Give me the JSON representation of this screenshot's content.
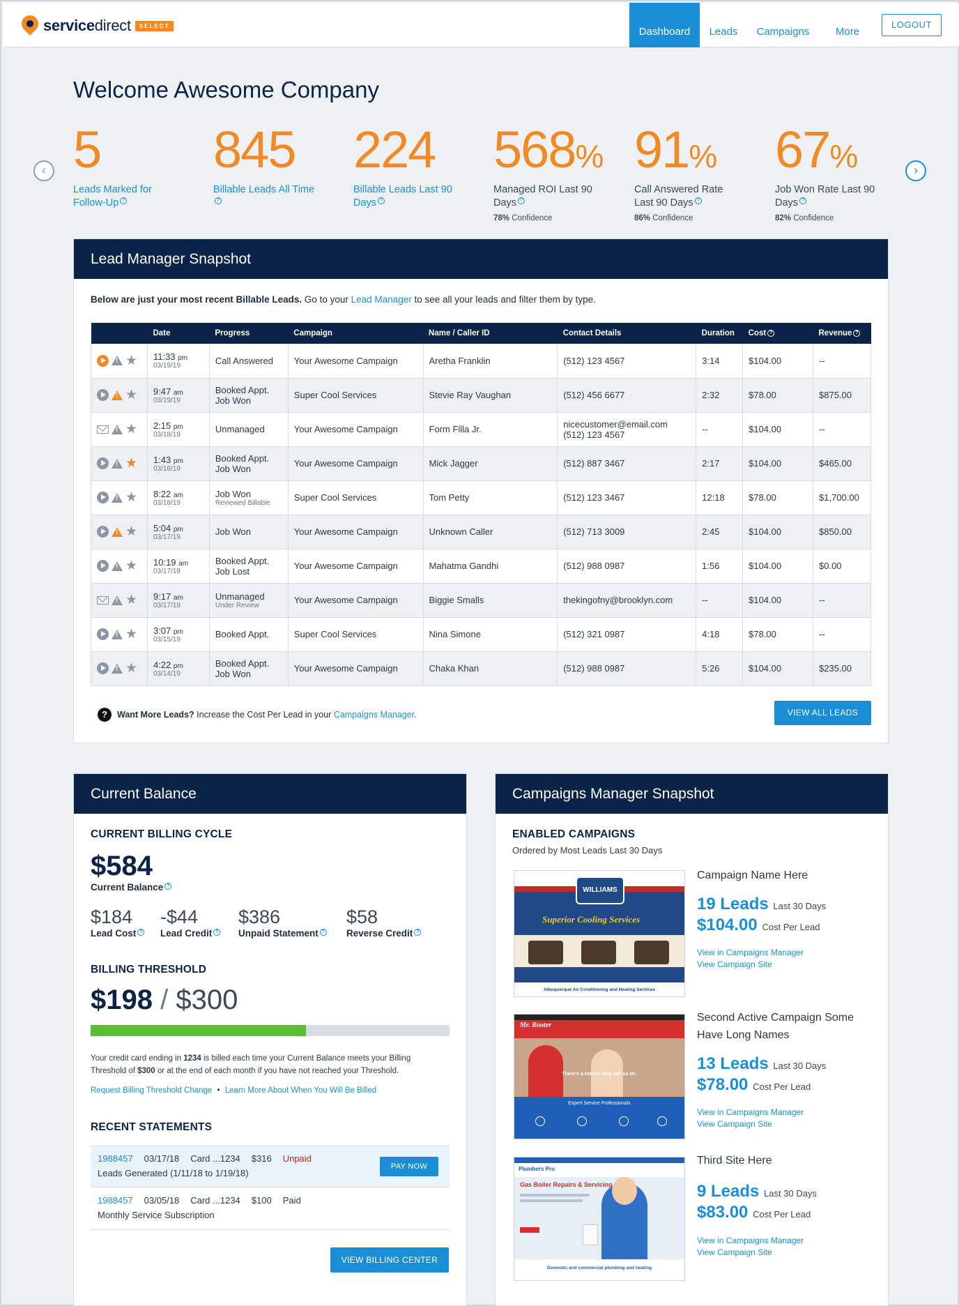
{
  "brand": {
    "name_bold": "service",
    "name_light": "direct",
    "badge": "SELECT"
  },
  "nav": {
    "items": [
      "Dashboard",
      "Leads",
      "Campaigns",
      "More"
    ],
    "logout": "LOGOUT"
  },
  "welcome": "Welcome Awesome Company",
  "stats": [
    {
      "value": "5",
      "suffix": "",
      "label": "Leads Marked for Follow-Up",
      "confidence_pct": "",
      "confidence_label": ""
    },
    {
      "value": "845",
      "suffix": "",
      "label": "Billable Leads All Time",
      "confidence_pct": "",
      "confidence_label": ""
    },
    {
      "value": "224",
      "suffix": "",
      "label": "Billable Leads Last 90 Days",
      "confidence_pct": "",
      "confidence_label": ""
    },
    {
      "value": "568",
      "suffix": "%",
      "label": "Managed ROI Last 90 Days",
      "confidence_pct": "78%",
      "confidence_label": "Confidence"
    },
    {
      "value": "91",
      "suffix": "%",
      "label": "Call Answered Rate Last 90 Days",
      "confidence_pct": "86%",
      "confidence_label": "Confidence"
    },
    {
      "value": "67",
      "suffix": "%",
      "label": "Job Won Rate Last 90 Days",
      "confidence_pct": "82%",
      "confidence_label": "Confidence"
    }
  ],
  "lead_snapshot": {
    "title": "Lead Manager Snapshot",
    "intro_bold": "Below are just your most recent Billable Leads.",
    "intro_pre": " Go to your ",
    "intro_link": "Lead Manager",
    "intro_post": " to see all your leads and filter them by type.",
    "columns": [
      "Date",
      "Progress",
      "Campaign",
      "Name / Caller ID",
      "Contact Details",
      "Duration",
      "Cost",
      "Revenue"
    ],
    "rows": [
      {
        "icon": "play",
        "play_on": true,
        "warn_on": false,
        "star_on": false,
        "time": "11:33",
        "ampm": "pm",
        "date": "03/19/19",
        "progress": "Call Answered",
        "progress2": "",
        "progress_sub": "",
        "campaign": "Your Awesome Campaign",
        "name": "Aretha Franklin",
        "contact": "(512) 123 4567",
        "contact2": "",
        "duration": "3:14",
        "cost": "$104.00",
        "revenue": "--"
      },
      {
        "icon": "play",
        "play_on": false,
        "warn_on": true,
        "star_on": false,
        "time": "9:47",
        "ampm": "am",
        "date": "03/19/19",
        "progress": "Booked Appt.",
        "progress2": "Job Won",
        "progress_sub": "",
        "campaign": "Super Cool Services",
        "name": "Stevie Ray Vaughan",
        "contact": "(512) 456 6677",
        "contact2": "",
        "duration": "2:32",
        "cost": "$78.00",
        "revenue": "$875.00"
      },
      {
        "icon": "mail",
        "play_on": false,
        "warn_on": false,
        "star_on": false,
        "time": "2:15",
        "ampm": "pm",
        "date": "03/18/19",
        "progress": "Unmanaged",
        "progress2": "",
        "progress_sub": "",
        "campaign": "Your Awesome Campaign",
        "name": "Form Filla Jr.",
        "contact": "nicecustomer@email.com",
        "contact2": "(512) 123 4567",
        "duration": "--",
        "cost": "$104.00",
        "revenue": "--"
      },
      {
        "icon": "play",
        "play_on": false,
        "warn_on": false,
        "star_on": true,
        "time": "1:43",
        "ampm": "pm",
        "date": "03/18/19",
        "progress": "Booked Appt.",
        "progress2": "Job Won",
        "progress_sub": "",
        "campaign": "Your Awesome Campaign",
        "name": "Mick Jagger",
        "contact": "(512) 887 3467",
        "contact2": "",
        "duration": "2:17",
        "cost": "$104.00",
        "revenue": "$465.00"
      },
      {
        "icon": "play",
        "play_on": false,
        "warn_on": false,
        "star_on": false,
        "time": "8:22",
        "ampm": "am",
        "date": "03/18/19",
        "progress": "Job Won",
        "progress2": "",
        "progress_sub": "Reviewed Billable",
        "campaign": "Super Cool Services",
        "name": "Tom Petty",
        "contact": "(512) 123 3467",
        "contact2": "",
        "duration": "12:18",
        "cost": "$78.00",
        "revenue": "$1,700.00"
      },
      {
        "icon": "play",
        "play_on": false,
        "warn_on": true,
        "star_on": false,
        "time": "5:04",
        "ampm": "pm",
        "date": "03/17/19",
        "progress": "Job Won",
        "progress2": "",
        "progress_sub": "",
        "campaign": "Your Awesome Campaign",
        "name": "Unknown Caller",
        "contact": "(512) 713 3009",
        "contact2": "",
        "duration": "2:45",
        "cost": "$104.00",
        "revenue": "$850.00"
      },
      {
        "icon": "play",
        "play_on": false,
        "warn_on": false,
        "star_on": false,
        "time": "10:19",
        "ampm": "am",
        "date": "03/17/19",
        "progress": "Booked Appt.",
        "progress2": "Job Lost",
        "progress_sub": "",
        "campaign": "Your Awesome Campaign",
        "name": "Mahatma Gandhi",
        "contact": "(512) 988 0987",
        "contact2": "",
        "duration": "1:56",
        "cost": "$104.00",
        "revenue": "$0.00"
      },
      {
        "icon": "mail",
        "play_on": false,
        "warn_on": false,
        "star_on": false,
        "time": "9:17",
        "ampm": "am",
        "date": "03/17/19",
        "progress": "Unmanaged",
        "progress2": "",
        "progress_sub": "Under Review",
        "campaign": "Your Awesome Campaign",
        "name": "Biggie Smalls",
        "contact": "thekingofny@brooklyn.com",
        "contact2": "",
        "duration": "--",
        "cost": "$104.00",
        "revenue": "--"
      },
      {
        "icon": "play",
        "play_on": false,
        "warn_on": false,
        "star_on": false,
        "time": "3:07",
        "ampm": "pm",
        "date": "03/15/19",
        "progress": "Booked Appt.",
        "progress2": "",
        "progress_sub": "",
        "campaign": "Super Cool Services",
        "name": "Nina Simone",
        "contact": "(512) 321 0987",
        "contact2": "",
        "duration": "4:18",
        "cost": "$78.00",
        "revenue": "--"
      },
      {
        "icon": "play",
        "play_on": false,
        "warn_on": false,
        "star_on": false,
        "time": "4:22",
        "ampm": "pm",
        "date": "03/14/19",
        "progress": "Booked Appt.",
        "progress2": "Job Won",
        "progress_sub": "",
        "campaign": "Your Awesome Campaign",
        "name": "Chaka Khan",
        "contact": "(512) 988 0987",
        "contact2": "",
        "duration": "5:26",
        "cost": "$104.00",
        "revenue": "$235.00"
      }
    ],
    "want_bold": "Want More Leads?",
    "want_text": " Increase the Cost Per Lead in your ",
    "want_link": "Campaigns Manager",
    "want_end": ".",
    "view_all": "VIEW ALL LEADS"
  },
  "balance": {
    "title": "Current Balance",
    "cycle_title": "CURRENT BILLING CYCLE",
    "amount": "$584",
    "amount_label": "Current Balance",
    "items": [
      {
        "value": "$184",
        "label": "Lead Cost"
      },
      {
        "value": "-$44",
        "label": "Lead Credit"
      },
      {
        "value": "$386",
        "label": "Unpaid Statement"
      },
      {
        "value": "$58",
        "label": "Reverse Credit"
      }
    ],
    "threshold_title": "BILLING THRESHOLD",
    "threshold_value": "$198",
    "threshold_sep": "/",
    "threshold_max": "$300",
    "threshold_fraction": 0.6,
    "fine_1a": "Your credit card ending in ",
    "fine_card": "1234",
    "fine_1b": " is billed each time your Current Balance meets your Billing",
    "fine_2a": "Threshold of ",
    "fine_amount": "$300",
    "fine_2b": " or at the end of each month if you have not reached your Threshold.",
    "link_request": "Request Billing Threshold Change",
    "link_sep": "•",
    "link_learn": "Learn More About When You Will Be Billed",
    "statements_title": "RECENT STATEMENTS",
    "statements": [
      {
        "id": "1988457",
        "date": "03/17/18",
        "card": "Card ...1234",
        "amount": "$316",
        "status": "Unpaid",
        "desc": "Leads Generated (1/11/18 to 1/19/18)",
        "action": "PAY NOW"
      },
      {
        "id": "1988457",
        "date": "03/05/18",
        "card": "Card ...1234",
        "amount": "$100",
        "status": "Paid",
        "desc": "Monthly Service  Subscription",
        "action": ""
      }
    ],
    "view_billing": "VIEW BILLING CENTER"
  },
  "campaigns": {
    "title": "Campaigns Manager Snapshot",
    "enabled_title": "ENABLED CAMPAIGNS",
    "enabled_sub": "Ordered by Most Leads Last 30 Days",
    "items": [
      {
        "name": "Campaign Name Here",
        "leads": "19 Leads",
        "leads_label": "Last 30 Days",
        "cost": "$104.00",
        "cost_label": "Cost Per Lead",
        "link1": "View in Campaigns Manager",
        "link2": "View Campaign Site",
        "site_title": "WILLIAMS",
        "site_tag": "Superior Cooling Services",
        "site_footer": "Albuquerque Air Conditioning and Heating Services"
      },
      {
        "name": "Second Active Campaign Some Have Long Names",
        "leads": "13 Leads",
        "leads_label": "Last 30 Days",
        "cost": "$78.00",
        "cost_label": "Cost Per Lead",
        "link1": "View in Campaigns Manager",
        "link2": "View Campaign Site",
        "site_title": "Mr. Rooter",
        "site_tag": "There's a reason they call us Mr.",
        "site_footer": "Expert Service Professionals"
      },
      {
        "name": "Third Site Here",
        "leads": "9 Leads",
        "leads_label": "Last 30 Days",
        "cost": "$83.00",
        "cost_label": "Cost Per Lead",
        "link1": "View in Campaigns Manager",
        "link2": "View Campaign Site",
        "site_title": "Plumbers Pro",
        "site_tag": "Gas Boiler Repairs & Servicing",
        "site_footer": "Domestic and commercial plumbing and heating"
      }
    ]
  },
  "colors": {
    "accent": "#1b8fd6",
    "orange": "#f08a24",
    "navy": "#0b2346",
    "green": "#5bbb3a",
    "unpaid": "#c82020"
  }
}
